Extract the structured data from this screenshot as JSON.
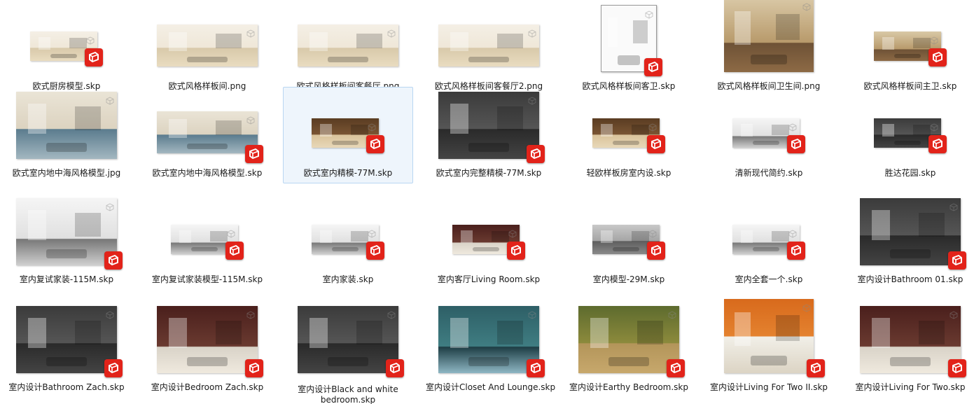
{
  "files": [
    {
      "label": "欧式厨房模型.skp",
      "type": "skp",
      "icon": "sketchup-file-icon"
    },
    {
      "label": "欧式风格样板间.png",
      "type": "png",
      "icon": "image-file-icon"
    },
    {
      "label": "欧式风格样板间客餐厅.png",
      "type": "png",
      "icon": "image-file-icon"
    },
    {
      "label": "欧式风格样板间客餐厅2.png",
      "type": "png",
      "icon": "image-file-icon"
    },
    {
      "label": "欧式风格样板间客卫.skp",
      "type": "skp",
      "icon": "sketchup-file-icon"
    },
    {
      "label": "欧式风格样板间卫生间.png",
      "type": "png",
      "icon": "image-file-icon"
    },
    {
      "label": "欧式风格样板间主卫.skp",
      "type": "skp",
      "icon": "sketchup-file-icon"
    },
    {
      "label": "欧式室内地中海风格模型.jpg",
      "type": "jpg",
      "icon": "image-file-icon"
    },
    {
      "label": "欧式室内地中海风格模型.skp",
      "type": "skp",
      "icon": "sketchup-file-icon"
    },
    {
      "label": "欧式室内精模-77M.skp",
      "type": "skp",
      "icon": "sketchup-file-icon",
      "selected": true
    },
    {
      "label": "欧式室内完整精模-77M.skp",
      "type": "skp",
      "icon": "sketchup-file-icon"
    },
    {
      "label": "轻欧样板房室内设.skp",
      "type": "skp",
      "icon": "sketchup-file-icon"
    },
    {
      "label": "清新现代简约.skp",
      "type": "skp",
      "icon": "sketchup-file-icon"
    },
    {
      "label": "胜达花园.skp",
      "type": "skp",
      "icon": "sketchup-file-icon"
    },
    {
      "label": "室内复试家装-115M.skp",
      "type": "skp",
      "icon": "sketchup-file-icon"
    },
    {
      "label": "室内复试家装模型-115M.skp",
      "type": "skp",
      "icon": "sketchup-file-icon"
    },
    {
      "label": "室内家装.skp",
      "type": "skp",
      "icon": "sketchup-file-icon"
    },
    {
      "label": "室内客厅Living Room.skp",
      "type": "skp",
      "icon": "sketchup-file-icon"
    },
    {
      "label": "室内模型-29M.skp",
      "type": "skp",
      "icon": "sketchup-file-icon"
    },
    {
      "label": "室内全套一个.skp",
      "type": "skp",
      "icon": "sketchup-file-icon"
    },
    {
      "label": "室内设计Bathroom 01.skp",
      "type": "skp",
      "icon": "sketchup-file-icon"
    },
    {
      "label": "室内设计Bathroom Zach.skp",
      "type": "skp",
      "icon": "sketchup-file-icon"
    },
    {
      "label": "室内设计Bedroom Zach.skp",
      "type": "skp",
      "icon": "sketchup-file-icon"
    },
    {
      "label": "室内设计Black and white bedroom.skp",
      "type": "skp",
      "icon": "sketchup-file-icon"
    },
    {
      "label": "室内设计Closet And Lounge.skp",
      "type": "skp",
      "icon": "sketchup-file-icon"
    },
    {
      "label": "室内设计Earthy Bedroom.skp",
      "type": "skp",
      "icon": "sketchup-file-icon"
    },
    {
      "label": "室内设计Living For Two II.skp",
      "type": "skp",
      "icon": "sketchup-file-icon"
    },
    {
      "label": "室内设计Living For Two.skp",
      "type": "skp",
      "icon": "sketchup-file-icon"
    }
  ],
  "colors": {
    "selection_bg": "#eef5fc",
    "selection_border": "#b9d6f2",
    "sketchup_badge": "#e2231a",
    "label_text": "#1a1a1a"
  }
}
